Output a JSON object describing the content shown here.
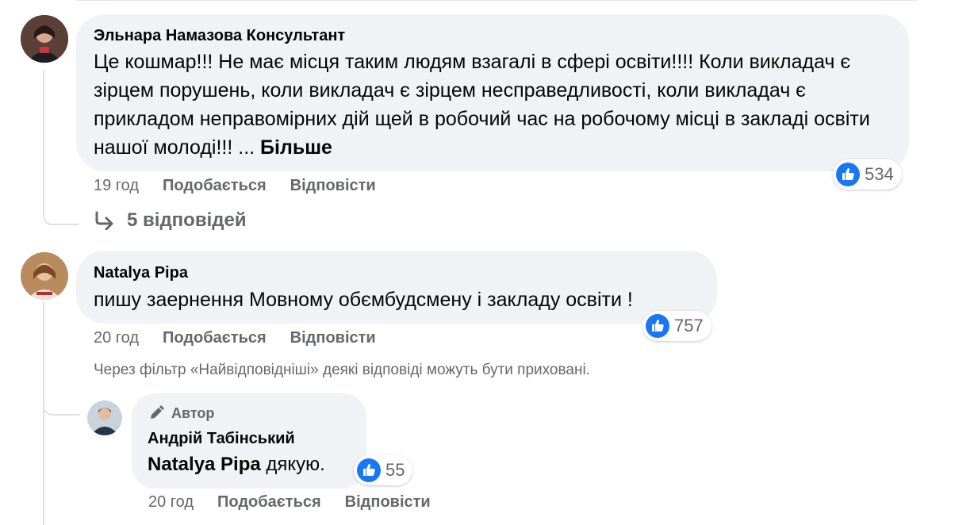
{
  "comments": [
    {
      "author": "Эльнара Намазова Консультант",
      "text": "Це кошмар!!! Не має місця таким людям взагалі в сфері освіти!!!! Коли викладач є зірцем порушень, коли викладач є зірцем несправедливості, коли викладач є прикладом неправомірних дій щей в робочий час на робочому місці в закладі освіти нашої молоді!!! ...",
      "more_label": "Більше",
      "time": "19 год",
      "like_label": "Подобається",
      "reply_label": "Відповісти",
      "reactions": "534",
      "replies_link": "5 відповідей"
    },
    {
      "author": "Natalya Pipa",
      "text": "пишу заернення Мовному обємбудсмену і закладу освіти !",
      "time": "20 год",
      "like_label": "Подобається",
      "reply_label": "Відповісти",
      "reactions": "757",
      "filter_notice": "Через фільтр «Найвідповідніші» деякі відповіді можуть бути приховані."
    }
  ],
  "reply": {
    "badge": "Автор",
    "author": "Андрій Табінський",
    "mention": "Natalya Pipa",
    "text": "дякую.",
    "time": "20 год",
    "like_label": "Подобається",
    "reply_label": "Відповісти",
    "reactions": "55"
  },
  "colors": {
    "bubble": "#f0f2f5",
    "like_blue": "#1877f2",
    "secondary_text": "#65676b"
  },
  "icons": [
    "like-icon",
    "reply-arrow-icon",
    "pencil-icon"
  ]
}
